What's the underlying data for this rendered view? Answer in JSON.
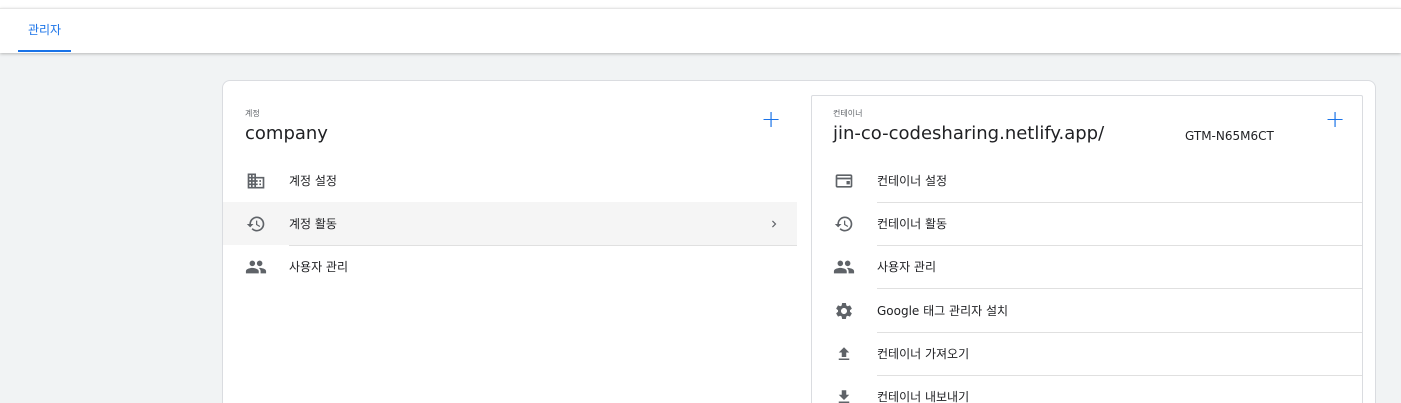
{
  "tabs": [
    {
      "label": "관리자"
    }
  ],
  "account": {
    "label": "계정",
    "title": "company",
    "items": [
      {
        "label": "계정 설정",
        "icon": "building-icon"
      },
      {
        "label": "계정 활동",
        "icon": "history-icon"
      },
      {
        "label": "사용자 관리",
        "icon": "people-icon"
      }
    ]
  },
  "container": {
    "label": "컨테이너",
    "title": "jin-co-codesharing.netlify.app/",
    "id": "GTM-N65M6CT",
    "items": [
      {
        "label": "컨테이너 설정",
        "icon": "web-window-icon"
      },
      {
        "label": "컨테이너 활동",
        "icon": "history-icon"
      },
      {
        "label": "사용자 관리",
        "icon": "people-icon"
      },
      {
        "label": "Google 태그 관리자 설치",
        "icon": "gear-icon"
      },
      {
        "label": "컨테이너 가져오기",
        "icon": "upload-icon"
      },
      {
        "label": "컨테이너 내보내기",
        "icon": "download-icon"
      }
    ]
  },
  "colors": {
    "accent": "#1a73e8",
    "icon": "#5f6368"
  }
}
